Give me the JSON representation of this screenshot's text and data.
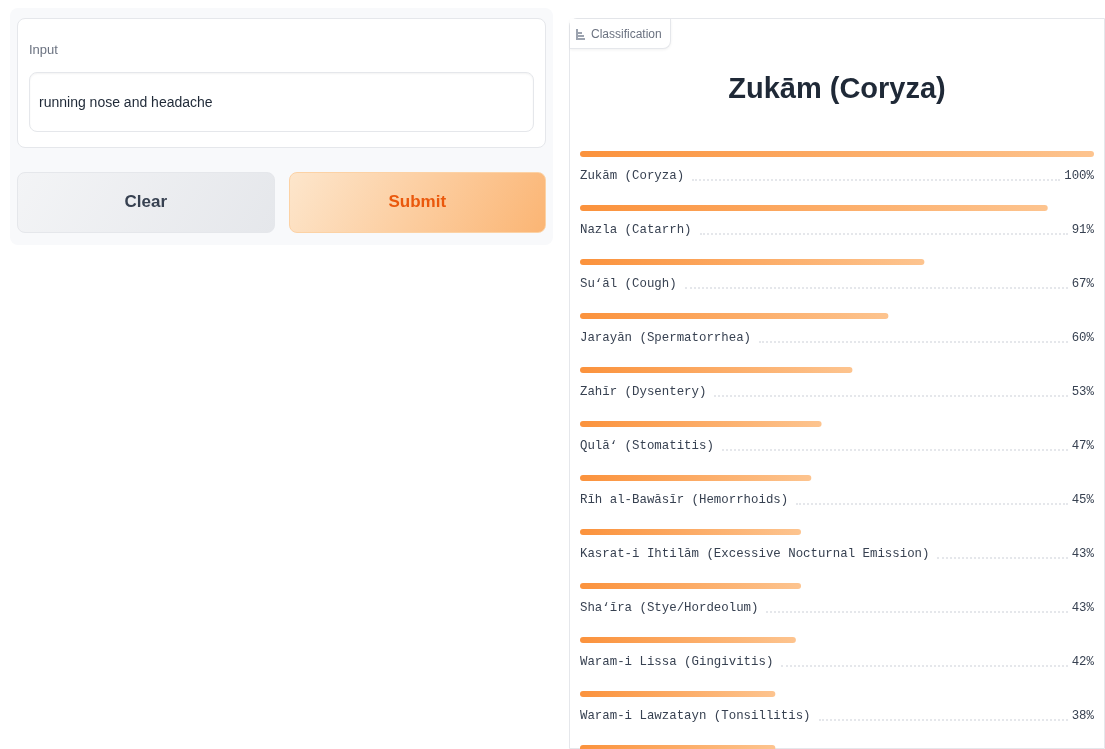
{
  "input_panel": {
    "label": "Input",
    "value": "running nose and headache"
  },
  "buttons": [
    {
      "kind": "secondary",
      "label": "Clear"
    },
    {
      "kind": "primary",
      "label": "Submit"
    }
  ],
  "output_panel": {
    "tab_label": "Classification",
    "top_label": "Zukām (Coryza)",
    "confidences": [
      {
        "label": "Zukām (Coryza)",
        "value": "100%",
        "level": 1.0
      },
      {
        "label": "Nazla (Catarrh)",
        "value": "91%",
        "level": 0.91
      },
      {
        "label": "Su‘āl (Cough)",
        "value": "67%",
        "level": 0.67
      },
      {
        "label": "Jarayān (Spermatorrhea)",
        "value": "60%",
        "level": 0.6
      },
      {
        "label": "Zahīr (Dysentery)",
        "value": "53%",
        "level": 0.53
      },
      {
        "label": "Qulā‘ (Stomatitis)",
        "value": "47%",
        "level": 0.47
      },
      {
        "label": "Rīh al-Bawāsīr (Hemorrhoids)",
        "value": "45%",
        "level": 0.45
      },
      {
        "label": "Kasrat-i Ihtilām (Excessive Nocturnal Emission)",
        "value": "43%",
        "level": 0.43
      },
      {
        "label": "Sha‘īra (Stye/Hordeolum)",
        "value": "43%",
        "level": 0.43
      },
      {
        "label": "Waram-i Lissa (Gingivitis)",
        "value": "42%",
        "level": 0.42
      },
      {
        "label": "Waram-i Lawzatayn (Tonsillitis)",
        "value": "38%",
        "level": 0.38
      },
      {
        "level": 0.38
      }
    ]
  }
}
